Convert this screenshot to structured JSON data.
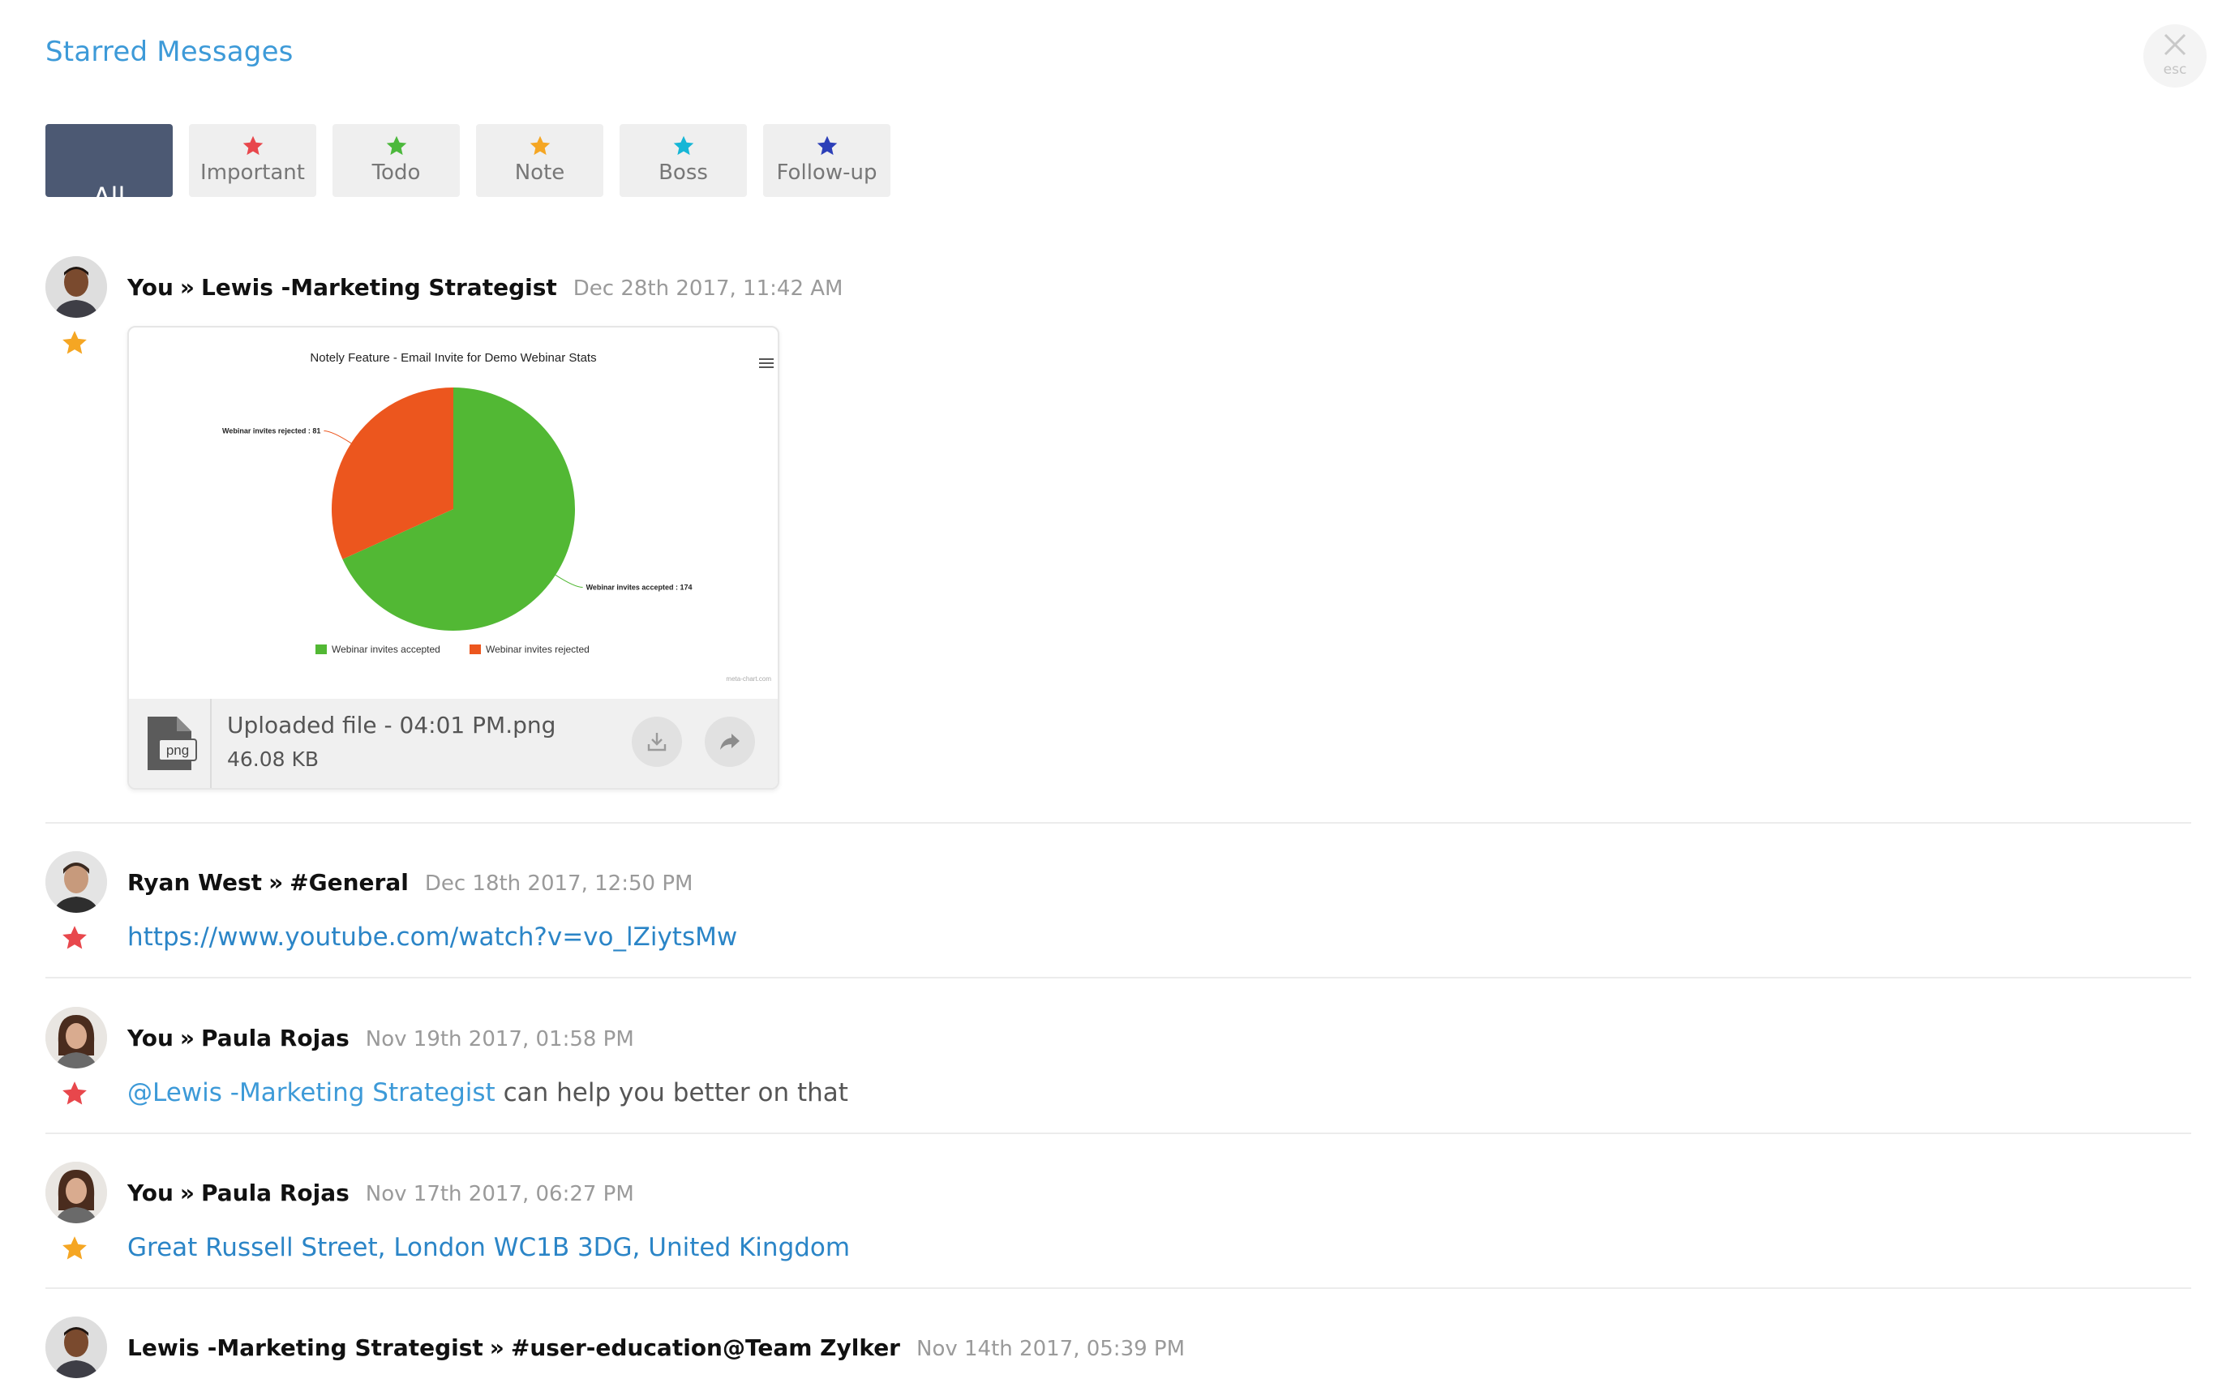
{
  "page": {
    "title": "Starred Messages",
    "close_label": "esc"
  },
  "filters": [
    {
      "label": "All",
      "active": true
    },
    {
      "label": "Important",
      "star_color": "#e8474c"
    },
    {
      "label": "Todo",
      "star_color": "#4cb83c"
    },
    {
      "label": "Note",
      "star_color": "#f5a623"
    },
    {
      "label": "Boss",
      "star_color": "#16b6d6"
    },
    {
      "label": "Follow-up",
      "star_color": "#2c3fb8"
    }
  ],
  "messages": [
    {
      "sender": "You",
      "separator": "»",
      "recipient": "Lewis -Marketing Strategist",
      "time": "Dec 28th 2017, 11:42 AM",
      "star_color": "#f5a623",
      "attachment": {
        "file_name": "Uploaded file - 04:01 PM.png",
        "file_size": "46.08 KB",
        "file_type": "png"
      }
    },
    {
      "sender": "Ryan West",
      "separator": "»",
      "recipient": "#General",
      "time": "Dec 18th 2017, 12:50 PM",
      "star_color": "#e8474c",
      "link": "https://www.youtube.com/watch?v=vo_lZiytsMw"
    },
    {
      "sender": "You",
      "separator": "»",
      "recipient": "Paula Rojas",
      "time": "Nov 19th 2017, 01:58 PM",
      "star_color": "#e8474c",
      "mention": "@Lewis -Marketing Strategist",
      "text": " can help you better on that"
    },
    {
      "sender": "You",
      "separator": "»",
      "recipient": "Paula Rojas",
      "time": "Nov 17th 2017, 06:27 PM",
      "star_color": "#f5a623",
      "link": "Great Russell Street, London WC1B 3DG, United Kingdom"
    },
    {
      "sender": "Lewis -Marketing Strategist",
      "separator": "»",
      "recipient": "#user-education@Team Zylker",
      "time": "Nov 14th 2017, 05:39 PM"
    }
  ],
  "chart_data": {
    "type": "pie",
    "title": "Notely Feature - Email Invite for Demo Webinar Stats",
    "series": [
      {
        "name": "Webinar invites accepted",
        "value": 174,
        "color": "#52b834"
      },
      {
        "name": "Webinar invites rejected",
        "value": 81,
        "color": "#ec561e"
      }
    ],
    "data_labels": [
      "Webinar invites accepted : 174",
      "Webinar invites rejected : 81"
    ],
    "legend": "bottom",
    "credit": "meta-chart.com"
  }
}
